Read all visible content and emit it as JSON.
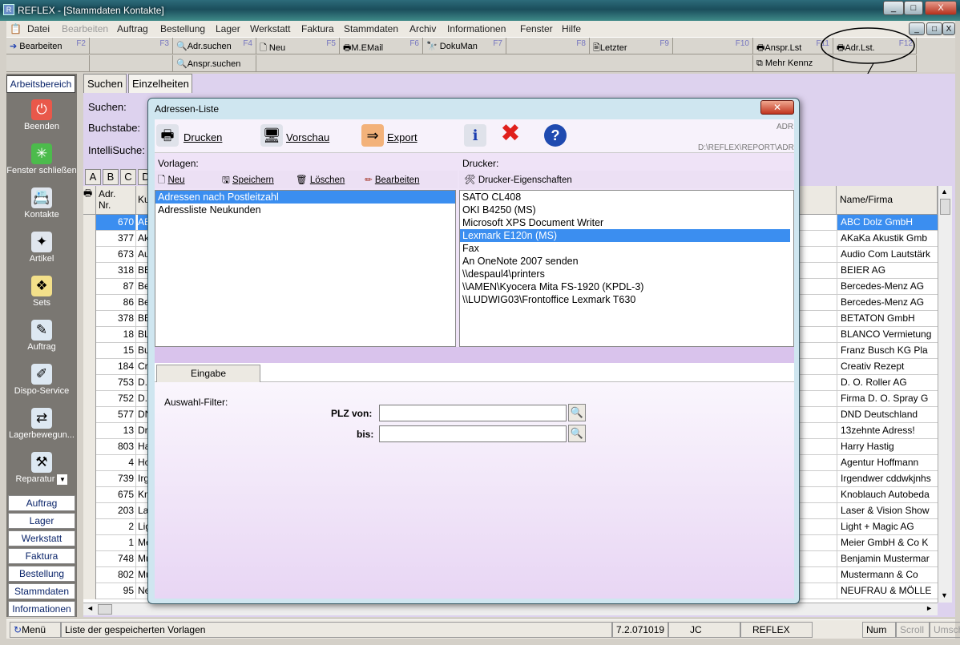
{
  "window": {
    "title": "REFLEX - [Stammdaten Kontakte]",
    "btn_min": "_",
    "btn_max": "□",
    "btn_close": "X"
  },
  "menubar": [
    "Datei",
    "Bearbeiten",
    "Auftrag",
    "Bestellung",
    "Lager",
    "Werkstatt",
    "Faktura",
    "Stammdaten",
    "Archiv",
    "Informationen",
    "Fenster",
    "Hilfe"
  ],
  "fkeys_row1": [
    {
      "label": "Bearbeiten",
      "num": "F2",
      "icon": "arrow-right-icon"
    },
    {
      "label": "",
      "num": "F3",
      "icon": ""
    },
    {
      "label": "Adr.suchen",
      "num": "F4",
      "icon": "search-icon"
    },
    {
      "label": "Neu",
      "num": "F5",
      "icon": "new-document-icon"
    },
    {
      "label": "M.EMail",
      "num": "F6",
      "icon": "email-icon"
    },
    {
      "label": "DokuMan",
      "num": "F7",
      "icon": "document-manager-icon"
    },
    {
      "label": "",
      "num": "F8",
      "icon": ""
    },
    {
      "label": "Letzter",
      "num": "F9",
      "icon": "last-icon"
    },
    {
      "label": "",
      "num": "F10",
      "icon": ""
    },
    {
      "label": "Anspr.Lst",
      "num": "F11",
      "icon": "printer-icon"
    },
    {
      "label": "Adr.Lst.",
      "num": "F12",
      "icon": "printer-icon"
    }
  ],
  "fkeys_row2": [
    {
      "label": "Anspr.suchen",
      "icon": "search-icon"
    },
    {
      "label": "Mehr Kennz",
      "icon": "copy-icon"
    }
  ],
  "leftbar": {
    "header": "Arbeitsbereich",
    "items": [
      {
        "label": "Beenden",
        "icon": "power-icon"
      },
      {
        "label": "Fenster schließen",
        "icon": "close-window-icon"
      },
      {
        "label": "Kontakte",
        "icon": "contacts-icon"
      },
      {
        "label": "Artikel",
        "icon": "article-icon"
      },
      {
        "label": "Sets",
        "icon": "sets-icon"
      },
      {
        "label": "Auftrag",
        "icon": "order-icon"
      },
      {
        "label": "Dispo-Service",
        "icon": "dispo-icon"
      },
      {
        "label": "Lagerbewegun...",
        "icon": "stock-movement-icon"
      },
      {
        "label": "Reparatur",
        "icon": "repair-icon"
      }
    ],
    "nav": [
      "Auftrag",
      "Lager",
      "Werkstatt",
      "Faktura",
      "Bestellung",
      "Stammdaten",
      "Informationen"
    ]
  },
  "main": {
    "tabs": [
      "Suchen",
      "Einzelheiten"
    ],
    "labels": {
      "suchen": "Suchen:",
      "buchstabe": "Buchstabe:",
      "intelli": "IntelliSuche:"
    },
    "letters": [
      "A",
      "B",
      "C",
      "D"
    ],
    "grid": {
      "col_nr": "Adr.\nNr.",
      "col_k": "Ku",
      "col_name": "Name/Firma",
      "rows": [
        {
          "nr": "670",
          "k": "AE",
          "name": "ABC Dolz GmbH"
        },
        {
          "nr": "377",
          "k": "Ak",
          "name": "AKaKa Akustik Gmb"
        },
        {
          "nr": "673",
          "k": "Au",
          "name": "Audio Com Lautstärk"
        },
        {
          "nr": "318",
          "k": "BE",
          "name": "BEIER AG"
        },
        {
          "nr": "87",
          "k": "Be",
          "name": "Bercedes-Menz AG"
        },
        {
          "nr": "86",
          "k": "Be",
          "name": "Bercedes-Menz AG"
        },
        {
          "nr": "378",
          "k": "BE",
          "name": "BETATON GmbH"
        },
        {
          "nr": "18",
          "k": "BL",
          "name": "BLANCO Vermietung"
        },
        {
          "nr": "15",
          "k": "Bu",
          "name": "Franz Busch KG Pla"
        },
        {
          "nr": "184",
          "k": "Cr",
          "name": "Creativ Rezept"
        },
        {
          "nr": "753",
          "k": "D.",
          "name": "D. O. Roller AG"
        },
        {
          "nr": "752",
          "k": "D.",
          "name": "Firma D. O. Spray G"
        },
        {
          "nr": "577",
          "k": "DN",
          "name": "DND Deutschland"
        },
        {
          "nr": "13",
          "k": "Dr",
          "name": "13zehnte Adress!"
        },
        {
          "nr": "803",
          "k": "Ha",
          "name": "Harry Hastig"
        },
        {
          "nr": "4",
          "k": "Ho",
          "name": "Agentur Hoffmann"
        },
        {
          "nr": "739",
          "k": "Irg",
          "name": "Irgendwer cddwkjnhs"
        },
        {
          "nr": "675",
          "k": "Kn",
          "name": "Knoblauch Autobeda"
        },
        {
          "nr": "203",
          "k": "La",
          "name": "Laser & Vision Show"
        },
        {
          "nr": "2",
          "k": "Lig",
          "name": "Light + Magic AG"
        },
        {
          "nr": "1",
          "k": "Me",
          "name": "Meier GmbH & Co K"
        },
        {
          "nr": "748",
          "k": "Mu",
          "name": "Benjamin Mustermar"
        },
        {
          "nr": "802",
          "k": "Mu",
          "name": "Mustermann & Co"
        },
        {
          "nr": "95",
          "k": "Ne",
          "name": "NEUFRAU & MÖLLE"
        }
      ]
    }
  },
  "dialog": {
    "title": "Adressen-Liste",
    "toolbar": {
      "print": "Drucken",
      "preview": "Vorschau",
      "export": "Export"
    },
    "path_hint": "ADR",
    "path": "D:\\REFLEX\\REPORT\\ADR",
    "vorlagen": {
      "label": "Vorlagen:",
      "new": "Neu",
      "save": "Speichern",
      "delete": "Löschen",
      "edit": "Bearbeiten",
      "items": [
        "Adressen nach Postleitzahl",
        "Adressliste Neukunden"
      ],
      "selected": 0
    },
    "drucker": {
      "label": "Drucker:",
      "props": "Drucker-Eigenschaften",
      "items": [
        "SATO CL408",
        "OKI B4250 (MS)",
        "Microsoft XPS Document Writer",
        "Lexmark E120n (MS)",
        "Fax",
        "An OneNote 2007 senden",
        "\\\\despaul4\\printers",
        "\\\\AMEN\\Kyocera Mita FS-1920 (KPDL-3)",
        "\\\\LUDWIG03\\Frontoffice Lexmark T630"
      ],
      "selected": 3
    },
    "tab": "Eingabe",
    "filter": {
      "label": "Auswahl-Filter:",
      "plz_from": "PLZ von:",
      "plz_to": "bis:",
      "plz_from_value": "",
      "plz_to_value": ""
    }
  },
  "statusbar": {
    "menu": "Menü",
    "hint": "Liste der gespeicherten Vorlagen",
    "version": "7.2.071019",
    "user": "JC",
    "app": "REFLEX",
    "num": "Num",
    "scroll": "Scroll",
    "umsch": "Umsch"
  }
}
